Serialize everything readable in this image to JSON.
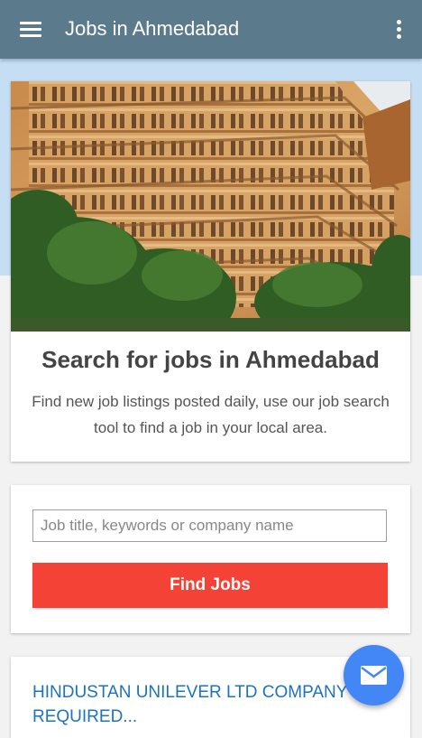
{
  "appbar": {
    "title": "Jobs in Ahmedabad",
    "menu_icon": "hamburger-menu-icon",
    "overflow_icon": "more-vert-icon",
    "color": "#5b7b8c"
  },
  "hero": {
    "image": "ahmedabad-haveli-photo",
    "title": "Search for jobs in Ahmedabad",
    "description": "Find new job listings posted daily, use our job search tool to find a job in your local area.",
    "background": "#c5def4"
  },
  "search": {
    "placeholder": "Job title, keywords or company name",
    "value": "",
    "button_label": "Find Jobs",
    "button_color": "#f44336"
  },
  "listings": [
    {
      "title": "HINDUSTAN UNILEVER LTD COMPANY REQUIRED..."
    }
  ],
  "fab": {
    "icon": "email-icon",
    "color": "#4287f5"
  },
  "colors": {
    "link": "#1e73be",
    "page_bg": "#f2f2f2"
  }
}
